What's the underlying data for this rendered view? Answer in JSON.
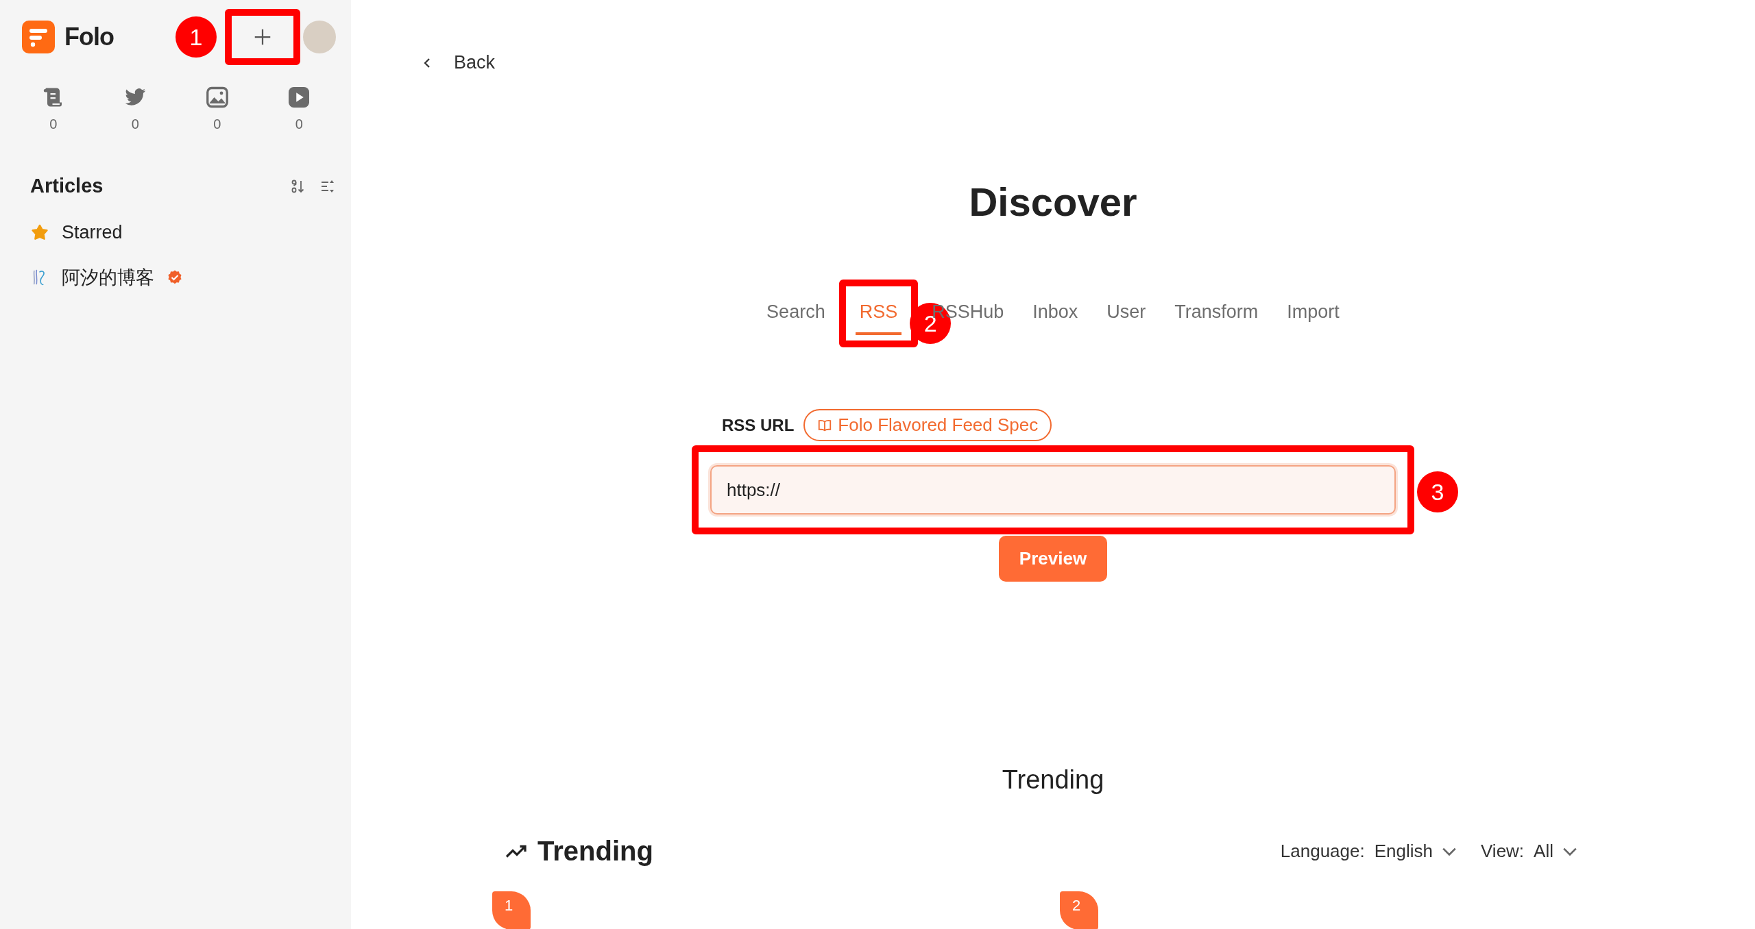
{
  "sidebar": {
    "app_name": "Folo",
    "add_button": {
      "step": "1"
    },
    "views": [
      {
        "kind": "article",
        "count": "0"
      },
      {
        "kind": "social",
        "count": "0"
      },
      {
        "kind": "picture",
        "count": "0"
      },
      {
        "kind": "video",
        "count": "0"
      }
    ],
    "section_title": "Articles",
    "feeds": [
      {
        "kind": "starred",
        "title": "Starred",
        "verified": false
      },
      {
        "kind": "feed",
        "title": "阿汐的博客",
        "verified": true
      }
    ]
  },
  "main": {
    "back": "Back",
    "title": "Discover",
    "tabs": [
      {
        "label": "Search",
        "selected": false
      },
      {
        "label": "RSS",
        "selected": true,
        "step": "2"
      },
      {
        "label": "RSSHub",
        "selected": false
      },
      {
        "label": "Inbox",
        "selected": false
      },
      {
        "label": "User",
        "selected": false
      },
      {
        "label": "Transform",
        "selected": false
      },
      {
        "label": "Import",
        "selected": false
      }
    ],
    "rss_url_label": "RSS URL",
    "spec_link": "Folo Flavored Feed Spec",
    "url_field": {
      "value": "https://",
      "step": "3"
    },
    "preview_button": "Preview",
    "trending": {
      "title": "Trending",
      "heading": "Trending",
      "language_label": "Language:",
      "language": "English",
      "view_label": "View:",
      "view": "All",
      "items": [
        {
          "rank": "1"
        },
        {
          "rank": "2"
        }
      ]
    }
  }
}
